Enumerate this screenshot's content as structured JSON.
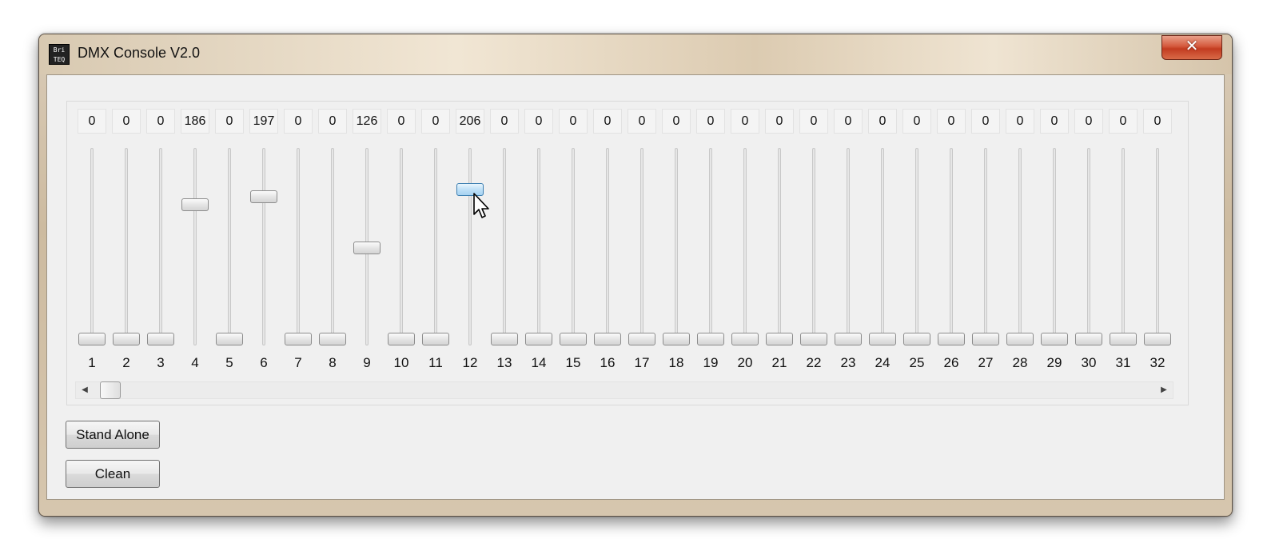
{
  "window": {
    "title": "DMX Console V2.0",
    "icon": "app-logo-icon",
    "icon_text_top": "Bri",
    "icon_text_bottom": "TEQ",
    "close_glyph": "✕"
  },
  "channels": [
    {
      "number": "1",
      "value": "0",
      "level": 0
    },
    {
      "number": "2",
      "value": "0",
      "level": 0
    },
    {
      "number": "3",
      "value": "0",
      "level": 0
    },
    {
      "number": "4",
      "value": "186",
      "level": 186
    },
    {
      "number": "5",
      "value": "0",
      "level": 0
    },
    {
      "number": "6",
      "value": "197",
      "level": 197
    },
    {
      "number": "7",
      "value": "0",
      "level": 0
    },
    {
      "number": "8",
      "value": "0",
      "level": 0
    },
    {
      "number": "9",
      "value": "126",
      "level": 126
    },
    {
      "number": "10",
      "value": "0",
      "level": 0
    },
    {
      "number": "11",
      "value": "0",
      "level": 0
    },
    {
      "number": "12",
      "value": "206",
      "level": 206,
      "active": true
    },
    {
      "number": "13",
      "value": "0",
      "level": 0
    },
    {
      "number": "14",
      "value": "0",
      "level": 0
    },
    {
      "number": "15",
      "value": "0",
      "level": 0
    },
    {
      "number": "16",
      "value": "0",
      "level": 0
    },
    {
      "number": "17",
      "value": "0",
      "level": 0
    },
    {
      "number": "18",
      "value": "0",
      "level": 0
    },
    {
      "number": "19",
      "value": "0",
      "level": 0
    },
    {
      "number": "20",
      "value": "0",
      "level": 0
    },
    {
      "number": "21",
      "value": "0",
      "level": 0
    },
    {
      "number": "22",
      "value": "0",
      "level": 0
    },
    {
      "number": "23",
      "value": "0",
      "level": 0
    },
    {
      "number": "24",
      "value": "0",
      "level": 0
    },
    {
      "number": "25",
      "value": "0",
      "level": 0
    },
    {
      "number": "26",
      "value": "0",
      "level": 0
    },
    {
      "number": "27",
      "value": "0",
      "level": 0
    },
    {
      "number": "28",
      "value": "0",
      "level": 0
    },
    {
      "number": "29",
      "value": "0",
      "level": 0
    },
    {
      "number": "30",
      "value": "0",
      "level": 0
    },
    {
      "number": "31",
      "value": "0",
      "level": 0
    },
    {
      "number": "32",
      "value": "0",
      "level": 0
    }
  ],
  "fader_max": 255,
  "scrollbar": {
    "left_arrow": "◀",
    "right_arrow": "▶",
    "position_fraction": 0
  },
  "buttons": {
    "stand_alone": "Stand Alone",
    "clean": "Clean"
  },
  "colors": {
    "active_thumb": "#a6d2f1",
    "close_button": "#c23b20"
  }
}
